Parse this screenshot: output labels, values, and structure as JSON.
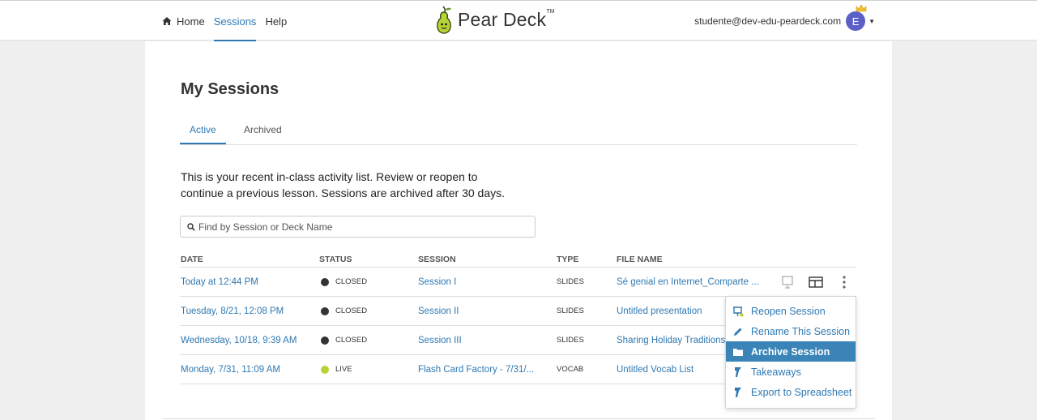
{
  "nav": {
    "home": "Home",
    "sessions": "Sessions",
    "help": "Help"
  },
  "brand": {
    "name": "Pear Deck",
    "tm": "TM"
  },
  "user": {
    "email": "studente@dev-edu-peardeck.com",
    "initial": "E"
  },
  "page": {
    "title": "My Sessions",
    "tabs": [
      "Active",
      "Archived"
    ],
    "intro": "This is your recent in-class activity list. Review or reopen to continue a previous lesson. Sessions are archived after 30 days.",
    "search_placeholder": "Find by Session or Deck Name"
  },
  "table": {
    "headers": [
      "DATE",
      "STATUS",
      "SESSION",
      "TYPE",
      "FILE NAME"
    ],
    "rows": [
      {
        "date": "Today at 12:44 PM",
        "status": "CLOSED",
        "session": "Session I",
        "type": "SLIDES",
        "file": "Sé genial en Internet_Comparte ..."
      },
      {
        "date": "Tuesday, 8/21, 12:08 PM",
        "status": "CLOSED",
        "session": "Session II",
        "type": "SLIDES",
        "file": "Untitled presentation"
      },
      {
        "date": "Wednesday, 10/18, 9:39 AM",
        "status": "CLOSED",
        "session": "Session III",
        "type": "SLIDES",
        "file": "Sharing Holiday Traditions"
      },
      {
        "date": "Monday, 7/31, 11:09 AM",
        "status": "LIVE",
        "session": "Flash Card Factory - 7/31/...",
        "type": "VOCAB",
        "file": "Untitled Vocab List"
      }
    ]
  },
  "menu": {
    "items": [
      "Reopen Session",
      "Rename This Session",
      "Archive Session",
      "Takeaways",
      "Export to Spreadsheet"
    ]
  },
  "colors": {
    "accent": "#2f79b3",
    "live": "#b5d334",
    "closed": "#333333",
    "menu_active": "#3a84b8",
    "avatar": "#5b5fc7"
  }
}
